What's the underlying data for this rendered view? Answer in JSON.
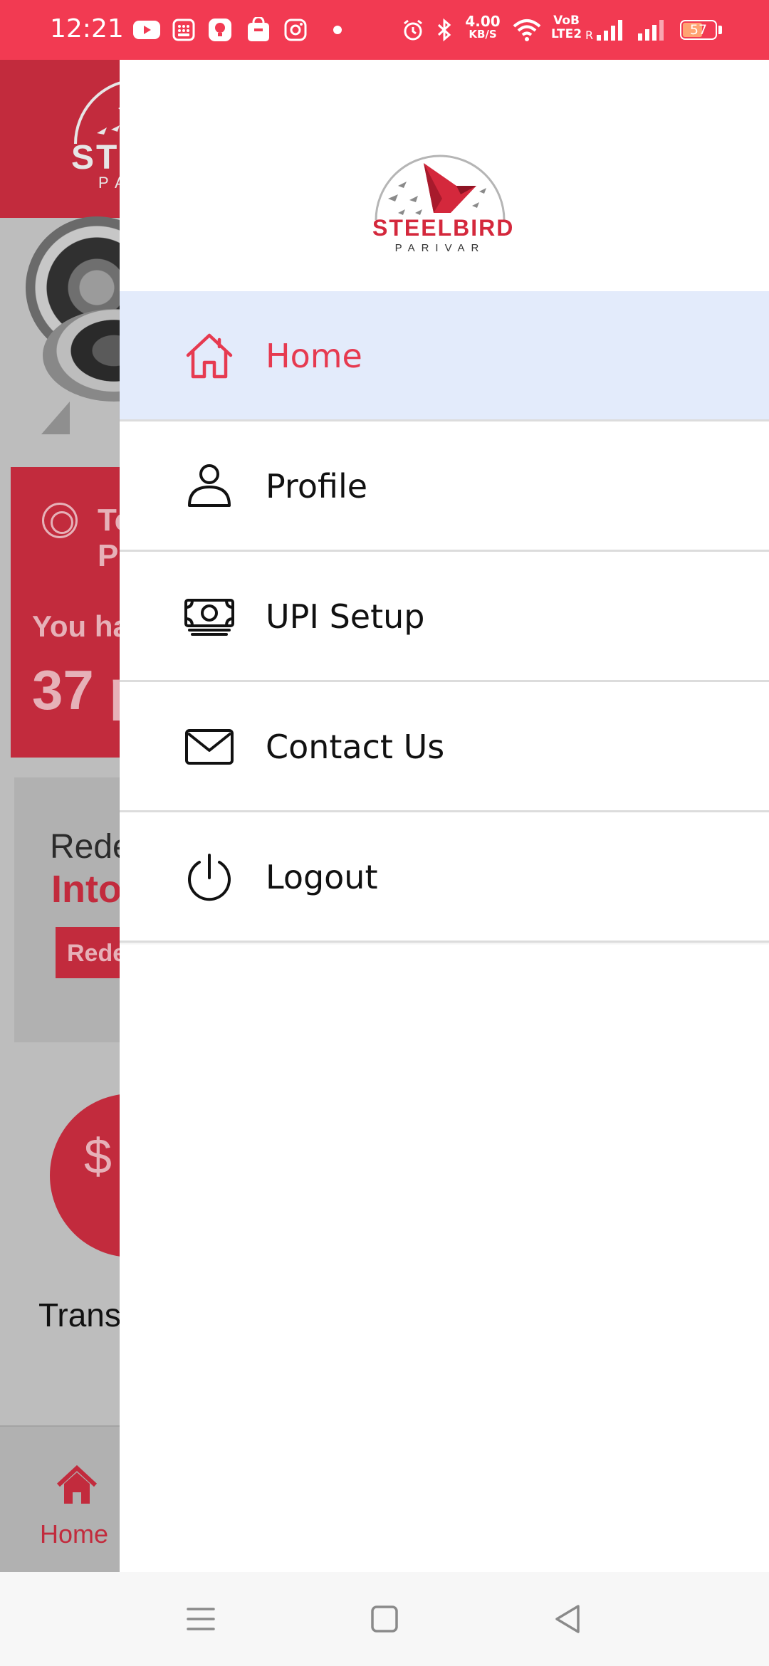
{
  "status_bar": {
    "time": "12:21",
    "net_speed": "4.00",
    "net_speed_unit": "KB/S",
    "volte": "VoB\nLTE2",
    "battery_level": "57",
    "sim_label": "R"
  },
  "background": {
    "logo_text": "STEELBIRD",
    "logo_sub": "PARIVAR",
    "points_title": "Total Points",
    "points_line": "You have",
    "points_value": "37 points",
    "redeem_line1": "Redeem",
    "redeem_line2": "Into",
    "redeem_button": "Redeem",
    "transactions_label": "Transactions",
    "nav_home_label": "Home"
  },
  "drawer": {
    "logo_text": "STEELBIRD",
    "logo_sub": "PARIVAR",
    "menu": [
      {
        "label": "Home",
        "icon": "home-icon",
        "active": true
      },
      {
        "label": "Profile",
        "icon": "user-icon",
        "active": false
      },
      {
        "label": "UPI Setup",
        "icon": "money-icon",
        "active": false
      },
      {
        "label": "Contact Us",
        "icon": "mail-icon",
        "active": false
      },
      {
        "label": "Logout",
        "icon": "power-icon",
        "active": false
      }
    ]
  },
  "system_nav": {
    "buttons": [
      "menu-icon",
      "home-square-icon",
      "back-icon"
    ]
  },
  "colors": {
    "status_bar": "#f23a52",
    "brand_red": "#d4283c",
    "active_item_bg": "#e3ebfb",
    "active_item_text": "#e63a50"
  }
}
